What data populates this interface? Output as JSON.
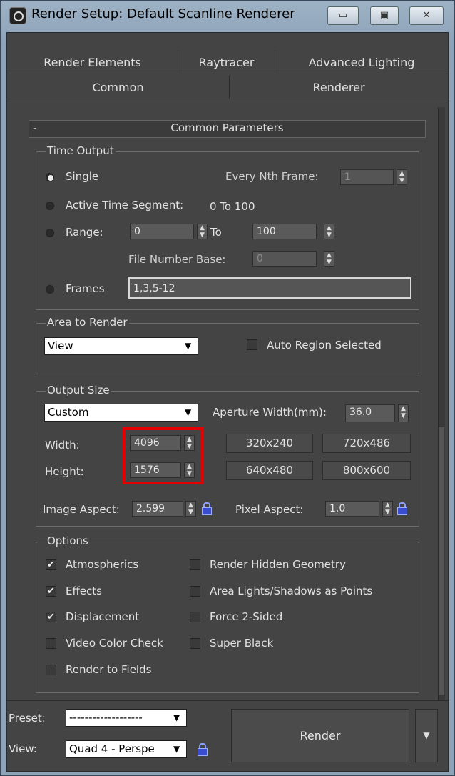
{
  "window": {
    "title": "Render Setup: Default Scanline Renderer",
    "minimize": "▭",
    "maximize": "▣",
    "close": "✕"
  },
  "tabs": {
    "row1": [
      "Render Elements",
      "Raytracer",
      "Advanced Lighting"
    ],
    "row2": [
      "Common",
      "Renderer"
    ]
  },
  "rollout": {
    "toggle": "-",
    "title": "Common Parameters"
  },
  "time_output": {
    "label": "Time Output",
    "single": "Single",
    "every_nth_label": "Every Nth Frame:",
    "every_nth_value": "1",
    "active_segment": "Active Time Segment:",
    "active_segment_value": "0 To 100",
    "range": "Range:",
    "range_from": "0",
    "range_to_label": "To",
    "range_to": "100",
    "file_number_base_label": "File Number Base:",
    "file_number_base": "0",
    "frames": "Frames",
    "frames_value": "1,3,5-12",
    "selected": "Single"
  },
  "area_to_render": {
    "label": "Area to Render",
    "value": "View",
    "auto_region": "Auto Region Selected",
    "auto_region_checked": false
  },
  "output_size": {
    "label": "Output Size",
    "preset": "Custom",
    "aperture_label": "Aperture Width(mm):",
    "aperture_value": "36.0",
    "width_label": "Width:",
    "width_value": "4096",
    "height_label": "Height:",
    "height_value": "1576",
    "presets": [
      "320x240",
      "720x486",
      "640x480",
      "800x600"
    ],
    "image_aspect_label": "Image Aspect:",
    "image_aspect_value": "2.599",
    "pixel_aspect_label": "Pixel Aspect:",
    "pixel_aspect_value": "1.0"
  },
  "options": {
    "label": "Options",
    "left": [
      {
        "label": "Atmospherics",
        "checked": true
      },
      {
        "label": "Effects",
        "checked": true
      },
      {
        "label": "Displacement",
        "checked": true
      },
      {
        "label": "Video Color Check",
        "checked": false
      },
      {
        "label": "Render to Fields",
        "checked": false
      }
    ],
    "right": [
      {
        "label": "Render Hidden Geometry",
        "checked": false
      },
      {
        "label": "Area Lights/Shadows as Points",
        "checked": false
      },
      {
        "label": "Force 2-Sided",
        "checked": false
      },
      {
        "label": "Super Black",
        "checked": false
      }
    ]
  },
  "bottom": {
    "preset_label": "Preset:",
    "preset_value": "-------------------",
    "view_label": "View:",
    "view_value": "Quad 4 - Perspe",
    "render_label": "Render"
  },
  "colors": {
    "highlight": "#e40000",
    "panel": "#444444"
  }
}
